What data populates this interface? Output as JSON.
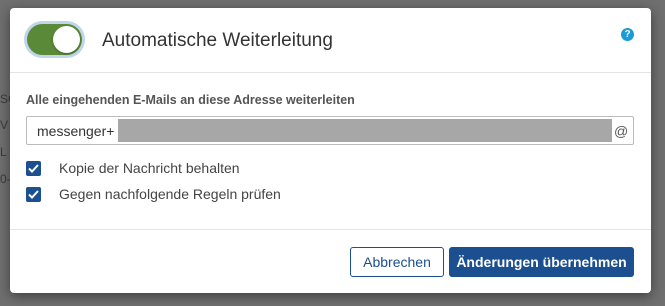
{
  "background_fragments": [
    "SC",
    "V",
    "L",
    "0-"
  ],
  "dialog": {
    "toggle": {
      "state": "on",
      "color": "#5a8a37"
    },
    "title": "Automatische Weiterleitung",
    "help_icon": "?",
    "field_label": "Alle eingehenden E-Mails an diese Adresse weiterleiten",
    "email": {
      "prefix": "messenger+",
      "suffix": "@"
    },
    "checkboxes": [
      {
        "label": "Kopie der Nachricht behalten",
        "checked": true
      },
      {
        "label": "Gegen nachfolgende Regeln prüfen",
        "checked": true
      }
    ],
    "buttons": {
      "cancel": "Abbrechen",
      "save": "Änderungen übernehmen"
    },
    "colors": {
      "primary": "#1c4f8f",
      "help": "#1a9ad6"
    }
  }
}
